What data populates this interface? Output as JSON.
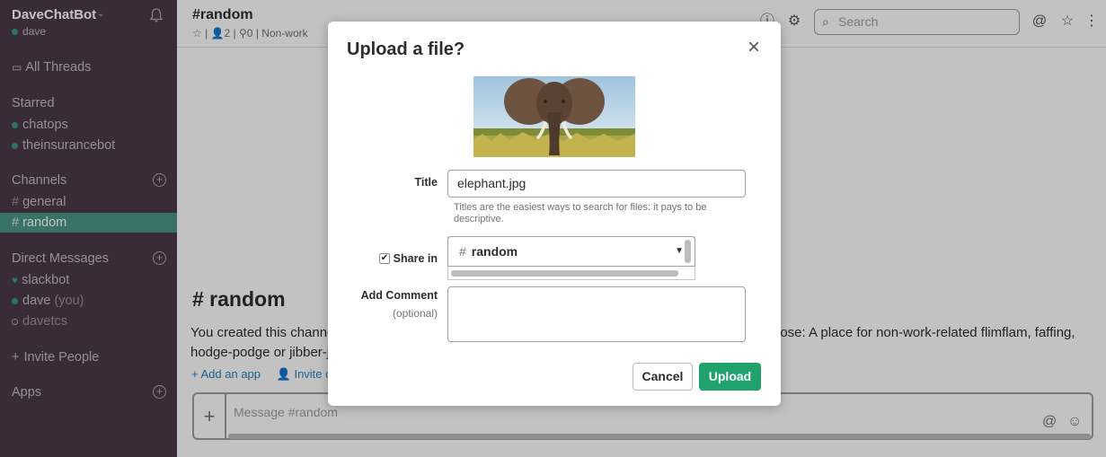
{
  "sidebar": {
    "workspace": "DaveChatBot",
    "user": "dave",
    "all_threads": "All Threads",
    "starred_heading": "Starred",
    "starred": [
      "chatops",
      "theinsurancebot"
    ],
    "channels_heading": "Channels",
    "channels": [
      "general",
      "random"
    ],
    "active_channel": "random",
    "dm_heading": "Direct Messages",
    "dms": [
      {
        "name": "slackbot",
        "suffix": ""
      },
      {
        "name": "dave",
        "suffix": "(you)"
      },
      {
        "name": "davetcs",
        "suffix": ""
      }
    ],
    "invite": "Invite People",
    "apps_heading": "Apps"
  },
  "header": {
    "channel": "#random",
    "members": "2",
    "pinned": "0",
    "topic": "Non-work",
    "search_placeholder": "Search"
  },
  "intro": {
    "title": "# random",
    "text_left1": "You created this channe",
    "text_right": "pose: A place for non-work-related flimflam, faffing,",
    "text_left2": "hodge-podge or jibber-j",
    "add_app": "Add an app",
    "invite": "Invite oth"
  },
  "composer": {
    "placeholder": "Message #random"
  },
  "modal": {
    "title": "Upload a file?",
    "title_label": "Title",
    "title_value": "elephant.jpg",
    "title_hint": "Titles are the easiest ways to search for files: it pays to be descriptive.",
    "share_label": "Share in",
    "share_checked": true,
    "share_value": "random",
    "comment_label": "Add Comment",
    "comment_sub": "(optional)",
    "cancel": "Cancel",
    "upload": "Upload",
    "accent": "#20a26c"
  }
}
